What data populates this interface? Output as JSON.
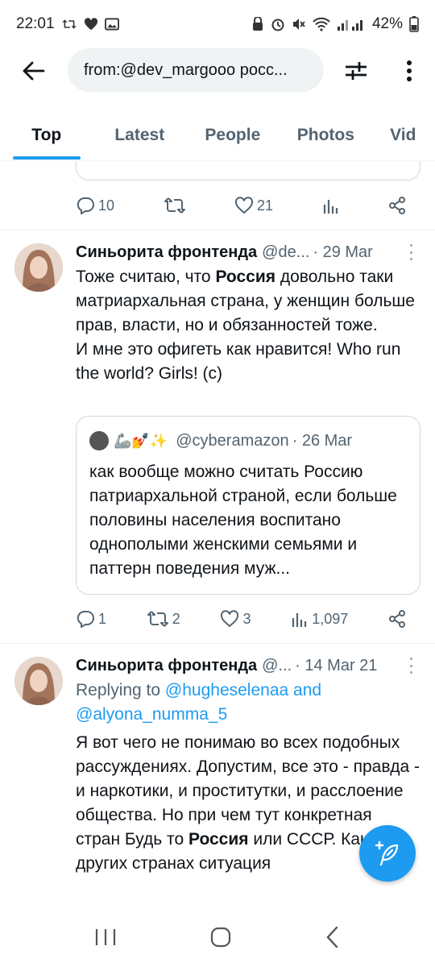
{
  "status_bar": {
    "time": "22:01",
    "battery": "42%"
  },
  "search": {
    "query": "from:@dev_margooo росс..."
  },
  "tabs": [
    {
      "label": "Top",
      "active": true
    },
    {
      "label": "Latest"
    },
    {
      "label": "People"
    },
    {
      "label": "Photos"
    },
    {
      "label": "Vid"
    }
  ],
  "prev_tweet": {
    "replies": "10",
    "likes": "21"
  },
  "tweet1": {
    "name": "Синьорита фронтенда",
    "handle": "@de...",
    "date": "· 29 Mar",
    "text_before": "Тоже считаю, что ",
    "text_bold": "Россия",
    "text_after": " довольно таки матриархальная страна, у женщин больше прав, власти, но и обязанностей тоже.",
    "text_line2": " И мне это офигеть как нравится! Who run the world? Girls! (c)",
    "quote": {
      "emoji": "🦾💅✨",
      "handle": "@cyberamazon",
      "date": "· 26 Mar",
      "text": "как вообще можно считать Россию патриархальной страной, если больше половины населения воспитано однополыми женскими семьями и паттерн поведения муж..."
    },
    "replies": "1",
    "retweets": "2",
    "likes": "3",
    "views": "1,097"
  },
  "tweet2": {
    "name": "Синьорита фронтенда",
    "handle": "@...",
    "date": "· 14 Mar 21",
    "replying_prefix": "Replying to ",
    "replying_user1": "@hugheselenaa",
    "replying_and": " and",
    "replying_user2": "@alyona_numma_5",
    "text_before": "Я вот чего не понимаю во всех подобных рассуждениях. Допустим, все это - правда - и наркотики, и проститутки, и расслоение общества. Но при чем тут конкретная стран Будь то ",
    "text_bold": "Россия",
    "text_after": " или СССР. Как буд других странах ситуация"
  },
  "colors": {
    "accent": "#1d9bf0",
    "text": "#0f1419",
    "secondary": "#536471",
    "border": "#cfd9de"
  }
}
